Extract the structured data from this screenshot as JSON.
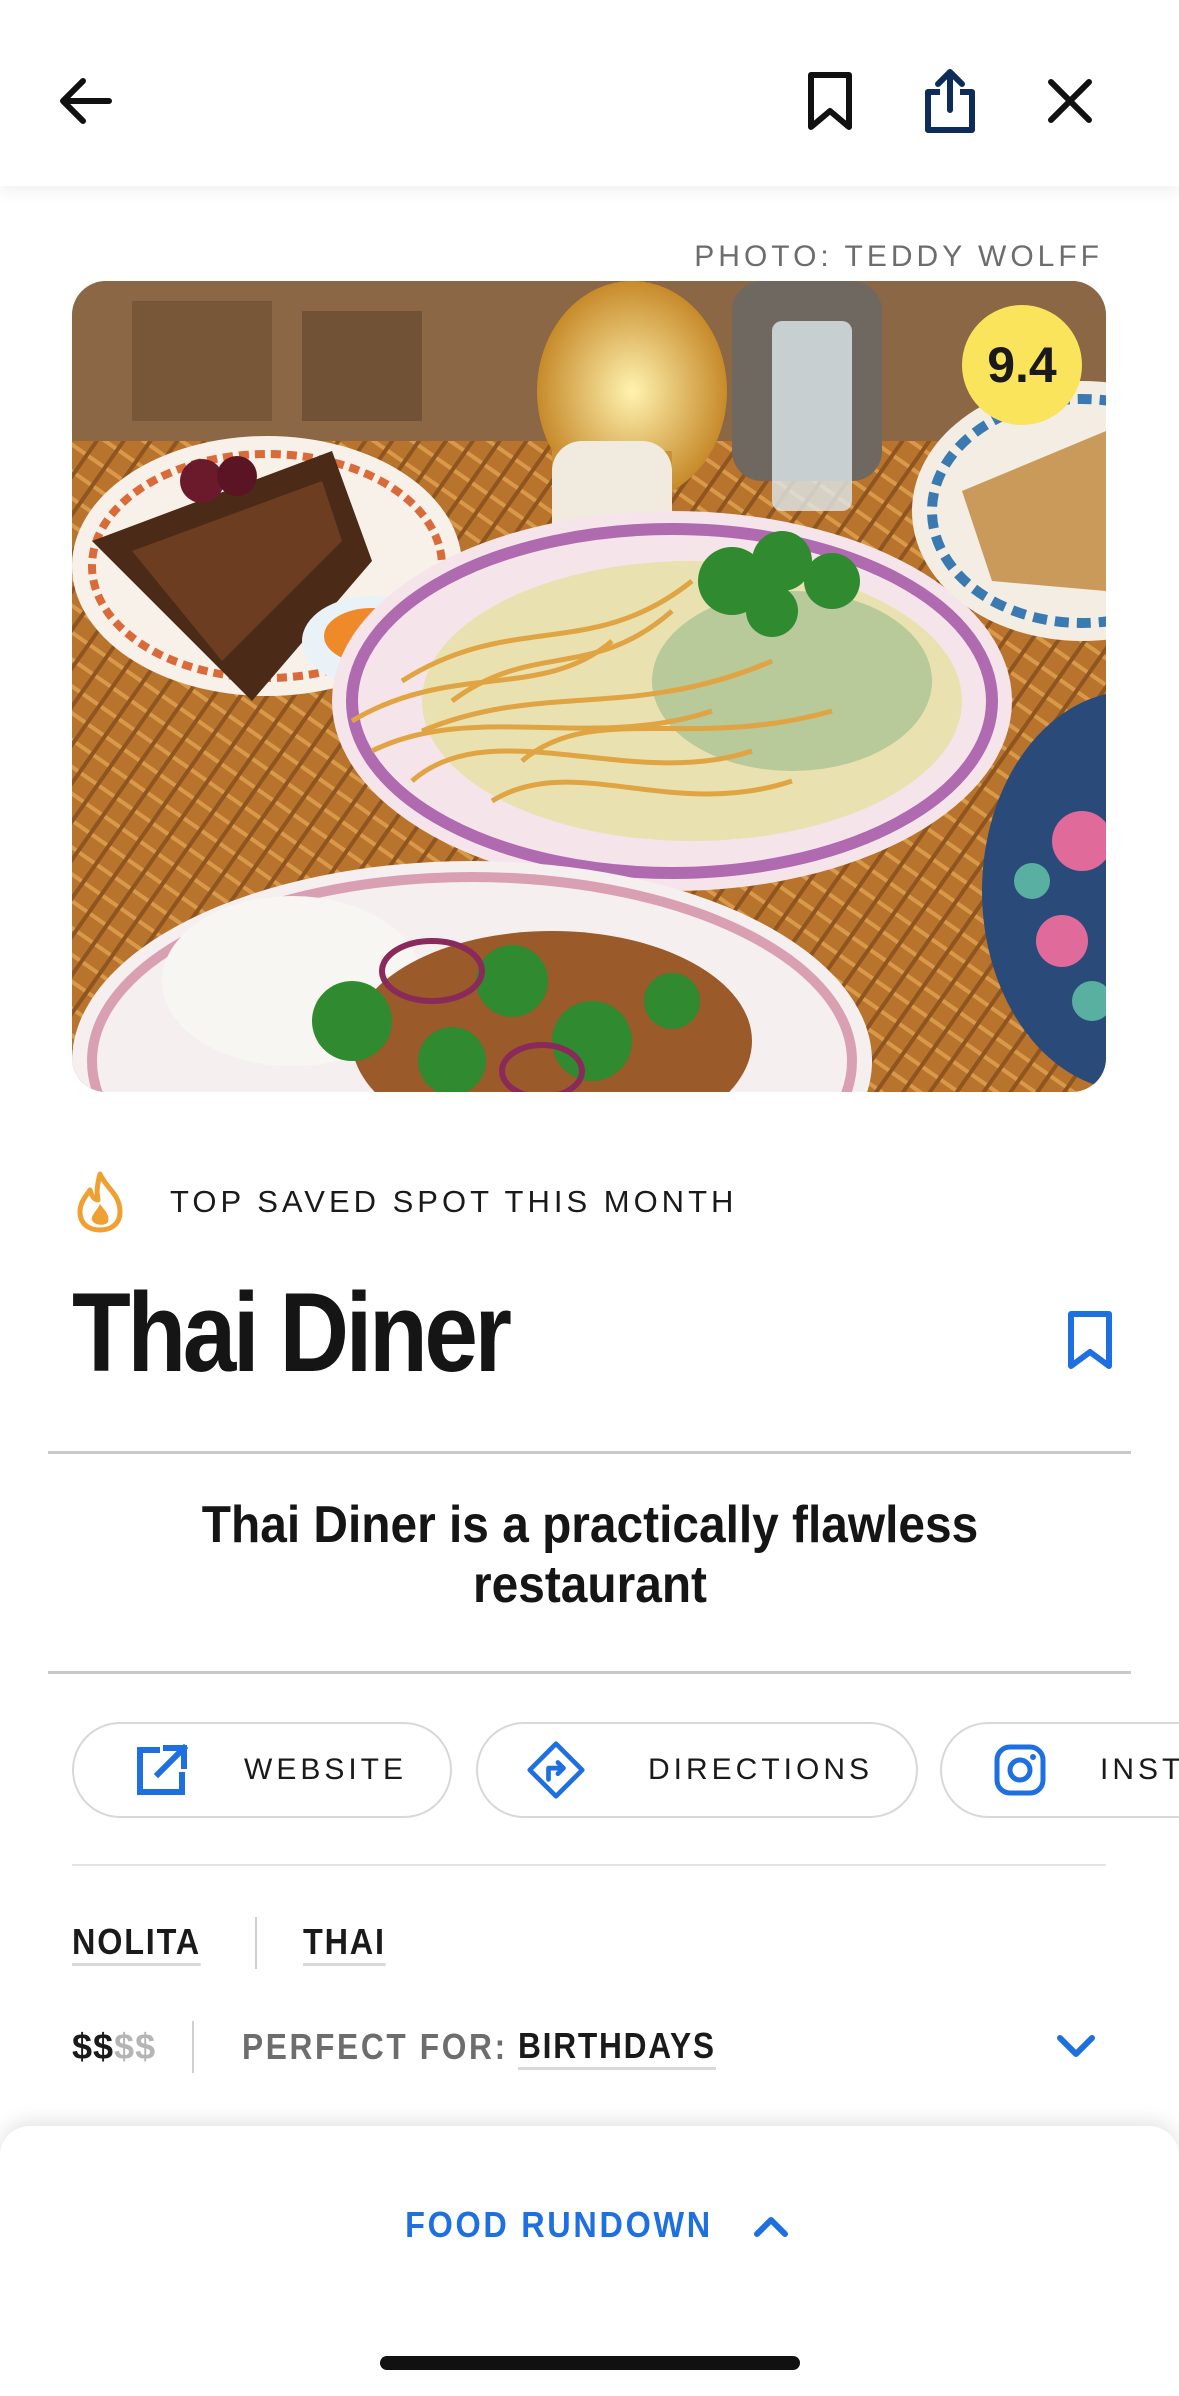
{
  "topbar": {
    "back_icon": "arrow-left-icon",
    "bookmark_icon": "bookmark-outline-icon",
    "share_icon": "share-icon",
    "close_icon": "close-icon"
  },
  "photo": {
    "credit": "PHOTO: TEDDY WOLFF",
    "score": "9.4"
  },
  "badge": {
    "icon": "flame-icon",
    "label": "TOP SAVED SPOT THIS MONTH"
  },
  "restaurant": {
    "name": "Thai Diner",
    "summary": "Thai Diner is a practically flawless restaurant"
  },
  "actions": [
    {
      "label": "WEBSITE",
      "icon": "external-link-icon"
    },
    {
      "label": "DIRECTIONS",
      "icon": "directions-icon"
    },
    {
      "label": "INSTAGRAM",
      "icon": "instagram-icon"
    }
  ],
  "tags": {
    "neighborhood": "NOLITA",
    "cuisine": "THAI"
  },
  "details": {
    "price_active": "$$",
    "price_inactive": "$$",
    "perfect_for_label": "PERFECT FOR:",
    "perfect_for_value": "BIRTHDAYS"
  },
  "sheet": {
    "label": "FOOD RUNDOWN"
  },
  "colors": {
    "accent": "#1e6fe0",
    "score_bg": "#f9e45b",
    "flame": "#f0a030"
  }
}
